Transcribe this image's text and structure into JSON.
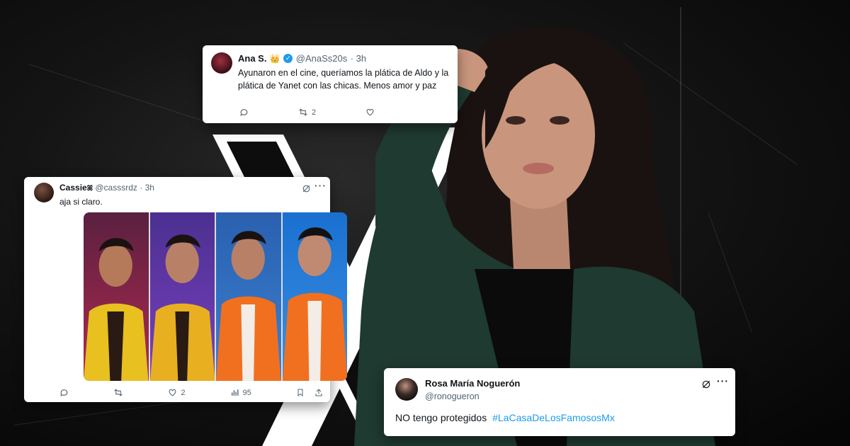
{
  "colors": {
    "link": "#1d9bf0",
    "text": "#0f1419",
    "muted": "#536471"
  },
  "tweet1": {
    "name": "Ana S.",
    "emoji": "👑",
    "handle": "@AnaSs20s",
    "time": "· 3h",
    "text": "Ayunaron en el cine, queríamos la plática de Aldo y la plática de Yanet con las chicas. Menos amor y paz",
    "retweets": "2"
  },
  "tweet2": {
    "name": "Cassie",
    "name_suffix": "ꕤ",
    "handle": "@casssrdz",
    "time": "· 3h",
    "text": "aja si claro.",
    "likes": "2",
    "views": "95"
  },
  "tweet3": {
    "name": "Rosa María Noguerón",
    "handle": "@ronogueron",
    "text_plain": "NO tengo protegidos",
    "hashtag": "#LaCasaDeLosFamososMx"
  },
  "icons": [
    "reply-icon",
    "retweet-icon",
    "like-icon",
    "views-icon",
    "bookmark-icon",
    "share-icon",
    "grok-icon",
    "more-icon",
    "verified-icon"
  ]
}
